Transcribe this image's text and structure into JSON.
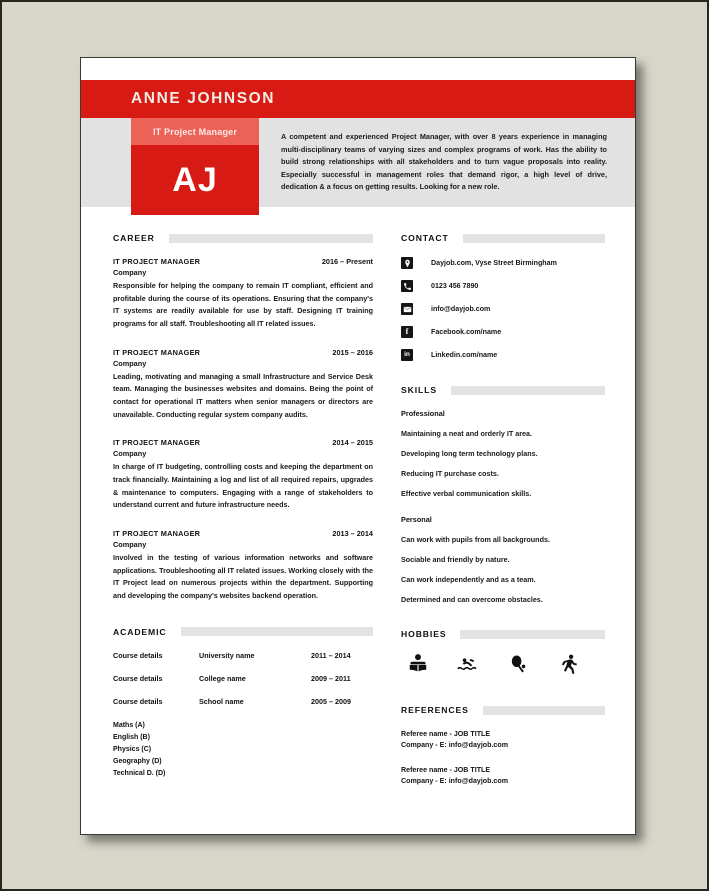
{
  "header": {
    "name": "ANNE JOHNSON",
    "job_title": "IT Project Manager",
    "initials": "AJ",
    "summary": "A competent and experienced Project Manager, with over 8 years experience in managing multi-disciplinary teams of varying sizes and complex programs of work. Has the ability to build strong relationships with all stakeholders and to turn vague proposals into reality. Especially successful in management roles that demand rigor, a high level of drive, dedication & a focus on getting results. Looking for a new role."
  },
  "colors": {
    "accent_red": "#d71b14",
    "accent_red_light": "#ec6257",
    "header_grey": "#e2e2e2",
    "bar_grey": "#e3e3e3",
    "page_background": "#d7d7ca",
    "icon_dark": "#151515"
  },
  "career": {
    "heading": "CAREER",
    "jobs": [
      {
        "title": "IT PROJECT MANAGER",
        "dates": "2016 – Present",
        "company": "Company",
        "description": "Responsible for helping the company to remain IT compliant, efficient and profitable during the course of its operations. Ensuring that the company's IT systems are readily available for use by staff. Designing IT training programs for all staff. Troubleshooting all IT related issues."
      },
      {
        "title": "IT PROJECT MANAGER",
        "dates": "2015 – 2016",
        "company": "Company",
        "description": "Leading, motivating and managing a small Infrastructure and Service Desk team. Managing the businesses websites and domains. Being the point of contact for operational IT matters when senior managers or directors are unavailable. Conducting regular system company audits."
      },
      {
        "title": "IT PROJECT MANAGER",
        "dates": "2014 – 2015",
        "company": "Company",
        "description": "In charge of IT budgeting, controlling costs and keeping the department on track financially. Maintaining a log and list of all required repairs, upgrades & maintenance to computers. Engaging with a range of stakeholders to understand current and future infrastructure needs."
      },
      {
        "title": "IT PROJECT MANAGER",
        "dates": "2013 – 2014",
        "company": "Company",
        "description": "Involved in the testing of various information networks and software applications. Troubleshooting all IT related issues. Working closely with the IT Project lead on numerous projects within the department. Supporting and developing the company's websites backend operation."
      }
    ]
  },
  "academic": {
    "heading": "ACADEMIC",
    "rows": [
      {
        "course": "Course details",
        "institution": "University name",
        "years": "2011 – 2014"
      },
      {
        "course": "Course details",
        "institution": "College name",
        "years": "2009 – 2011"
      },
      {
        "course": "Course details",
        "institution": "School name",
        "years": "2005 – 2009"
      }
    ],
    "grades": [
      "Maths (A)",
      "English (B)",
      "Physics (C)",
      "Geography (D)",
      "Technical D. (D)"
    ]
  },
  "contact": {
    "heading": "CONTACT",
    "items": [
      {
        "icon": "location-pin-icon",
        "text": "Dayjob.com, Vyse Street Birmingham"
      },
      {
        "icon": "phone-icon",
        "text": "0123 456 7890"
      },
      {
        "icon": "email-icon",
        "text": "info@dayjob.com"
      },
      {
        "icon": "facebook-icon",
        "text": "Facebook.com/name"
      },
      {
        "icon": "linkedin-icon",
        "text": "Linkedin.com/name"
      }
    ]
  },
  "skills": {
    "heading": "SKILLS",
    "groups": [
      {
        "title": "Professional",
        "items": [
          "Maintaining a neat and orderly IT area.",
          "Developing long term technology plans.",
          "Reducing IT purchase costs.",
          "Effective verbal communication skills."
        ]
      },
      {
        "title": "Personal",
        "items": [
          "Can work with pupils from all backgrounds.",
          "Sociable and friendly by nature.",
          "Can work independently and as a team.",
          "Determined and can overcome obstacles."
        ]
      }
    ]
  },
  "hobbies": {
    "heading": "HOBBIES",
    "icons": [
      "reading-icon",
      "swimming-icon",
      "racket-sport-icon",
      "running-icon"
    ]
  },
  "references": {
    "heading": "REFERENCES",
    "items": [
      {
        "line1": "Referee name - JOB TITLE",
        "line2": "Company - E: info@dayjob.com"
      },
      {
        "line1": "Referee name - JOB TITLE",
        "line2": "Company - E: info@dayjob.com"
      }
    ]
  }
}
